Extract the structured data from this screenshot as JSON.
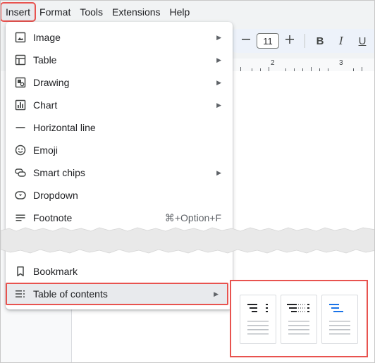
{
  "menubar": {
    "items": [
      "Insert",
      "Format",
      "Tools",
      "Extensions",
      "Help"
    ]
  },
  "toolbar": {
    "minus_icon": "minus-icon",
    "font_size": "11",
    "plus_icon": "plus-icon",
    "bold": "B",
    "italic": "I",
    "underline": "U"
  },
  "ruler": {
    "labels": [
      "2",
      "3"
    ]
  },
  "insert_menu": {
    "items": [
      {
        "label": "Image",
        "icon": "image-icon",
        "submenu": true
      },
      {
        "label": "Table",
        "icon": "table-icon",
        "submenu": true
      },
      {
        "label": "Drawing",
        "icon": "drawing-icon",
        "submenu": true
      },
      {
        "label": "Chart",
        "icon": "chart-icon",
        "submenu": true
      },
      {
        "label": "Horizontal line",
        "icon": "horizontal-line-icon",
        "submenu": false
      },
      {
        "label": "Emoji",
        "icon": "emoji-icon",
        "submenu": false
      },
      {
        "label": "Smart chips",
        "icon": "smart-chips-icon",
        "submenu": true
      },
      {
        "label": "Dropdown",
        "icon": "dropdown-icon",
        "submenu": false
      },
      {
        "label": "Footnote",
        "icon": "footnote-icon",
        "submenu": false,
        "shortcut": "⌘+Option+F"
      },
      {
        "label": "Bookmark",
        "icon": "bookmark-icon",
        "submenu": false
      },
      {
        "label": "Table of contents",
        "icon": "table-of-contents-icon",
        "submenu": true
      }
    ],
    "submenu_arrow": "▶"
  },
  "toc_submenu": {
    "options": [
      "toc-plain-numbers",
      "toc-dotted-numbers",
      "toc-blue-links"
    ],
    "link_color": "#1a73e8"
  },
  "colors": {
    "highlight": "#e8534f",
    "menubar_bg": "#f1f3f4"
  }
}
